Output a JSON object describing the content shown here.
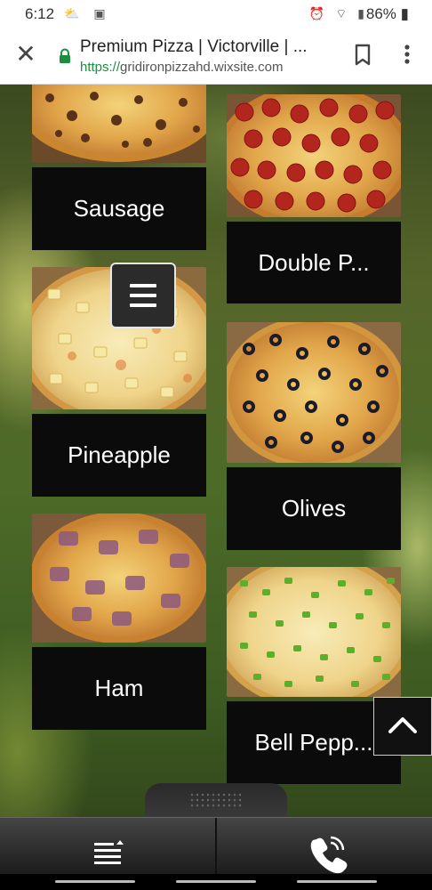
{
  "status_bar": {
    "time": "6:12",
    "left_icons": "⛅ ▣",
    "right_icons": "⏰ ⌔ ▮",
    "battery": "86% ▮"
  },
  "browser": {
    "title": "Premium Pizza | Victorville | ...",
    "url_scheme": "https://",
    "url_host": "gridironpizzahd.wixsite.com"
  },
  "cards": [
    {
      "name": "Sausage",
      "topping": "sausage"
    },
    {
      "name": "Double P...",
      "topping": "pepperoni"
    },
    {
      "name": "Pineapple",
      "topping": "pineapple"
    },
    {
      "name": "Olives",
      "topping": "olives"
    },
    {
      "name": "Ham",
      "topping": "ham"
    },
    {
      "name": "Bell Pepp...",
      "topping": "bell-pepper"
    }
  ],
  "icons": {
    "close": "close-icon",
    "lock": "lock-icon",
    "bookmark": "bookmark-icon",
    "overflow": "more-vert-icon",
    "site_menu": "hamburger-icon",
    "scroll_top": "chevron-up-icon",
    "bottom_menu": "menu-icon",
    "call": "phone-icon"
  },
  "colors": {
    "url_scheme": "#1e8e3e",
    "card_label_bg": "#0b0b0b",
    "toolbar_bg": "#2a2a2a"
  }
}
